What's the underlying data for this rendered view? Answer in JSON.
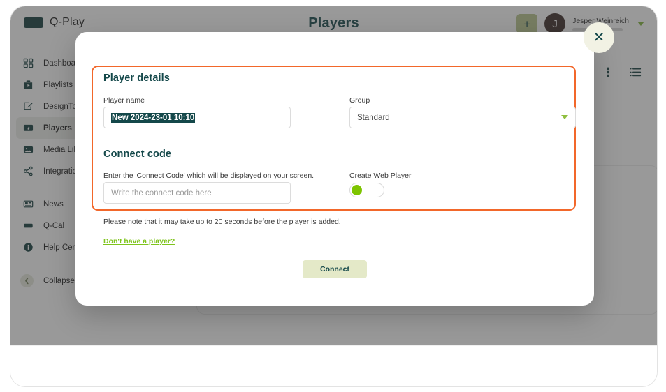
{
  "app": {
    "logo_text": "Q-Play",
    "page_title": "Players"
  },
  "topbar": {
    "add_label": "+",
    "avatar_initial": "J",
    "user_name": "Jesper Weinreich"
  },
  "sidebar": {
    "items": [
      {
        "label": "Dashboard",
        "icon": "grid-icon"
      },
      {
        "label": "Playlists",
        "icon": "playlist-icon"
      },
      {
        "label": "DesignTool",
        "icon": "design-pen-icon"
      },
      {
        "label": "Players",
        "icon": "monitor-icon"
      },
      {
        "label": "Media Library",
        "icon": "image-icon"
      },
      {
        "label": "Integrations",
        "icon": "share-icon"
      }
    ],
    "items_secondary": [
      {
        "label": "News",
        "icon": "news-icon"
      },
      {
        "label": "Q-Cal",
        "icon": "calendar-icon"
      },
      {
        "label": "Help Center",
        "icon": "info-icon"
      }
    ],
    "collapse_label": "Collapse menu",
    "collapse_icon": "chevron-left-icon"
  },
  "content": {
    "grid_view_icon": "grid-view-icon",
    "list_view_icon": "list-view-icon"
  },
  "modal": {
    "close_icon": "close-icon",
    "player_details_title": "Player details",
    "player_name_label": "Player name",
    "player_name_value": "New 2024-23-01 10:10",
    "group_label": "Group",
    "group_value": "Standard",
    "group_chevron_icon": "chevron-down-icon",
    "connect_code_title": "Connect code",
    "connect_code_label": "Enter the 'Connect Code' which will be displayed on your screen.",
    "connect_code_placeholder": "Write the connect code here",
    "connect_code_value": "",
    "web_player_label": "Create Web Player",
    "web_player_state": "off",
    "note": "Please note that it may take up to 20 seconds before the player is added.",
    "help_link": "Don't have a player?",
    "connect_button": "Connect"
  },
  "colors": {
    "accent_orange": "#f2672a",
    "brand_teal": "#14484a",
    "green": "#7dc400",
    "button_bg": "#e4e9c8"
  }
}
